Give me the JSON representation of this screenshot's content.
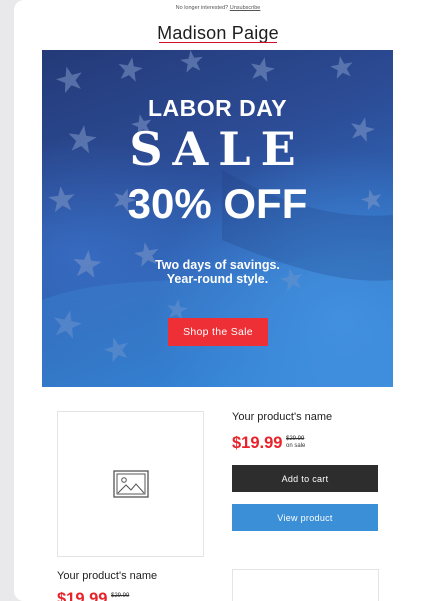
{
  "preheader": {
    "text": "No longer interested?",
    "link": "Unsubscribe"
  },
  "brand": {
    "name": "Madison Paige",
    "accent": "#d0112b"
  },
  "hero": {
    "line1": "LABOR DAY",
    "line2": "SALE",
    "line3": "30% OFF",
    "sub1": "Two days of savings.",
    "sub2": "Year-round style.",
    "cta": "Shop the Sale",
    "cta_color": "#ee2f35"
  },
  "products": [
    {
      "name": "Your product's name",
      "price": "$19.99",
      "old_price": "$29.99",
      "note": "on sale",
      "add_label": "Add to cart",
      "view_label": "View product",
      "image_icon": "image-placeholder-icon"
    },
    {
      "name": "Your product's name",
      "price": "$19.99",
      "old_price": "$29.99"
    }
  ],
  "colors": {
    "price": "#e8232a",
    "add_button": "#2d2d2d",
    "view_button": "#3a8fd6"
  }
}
